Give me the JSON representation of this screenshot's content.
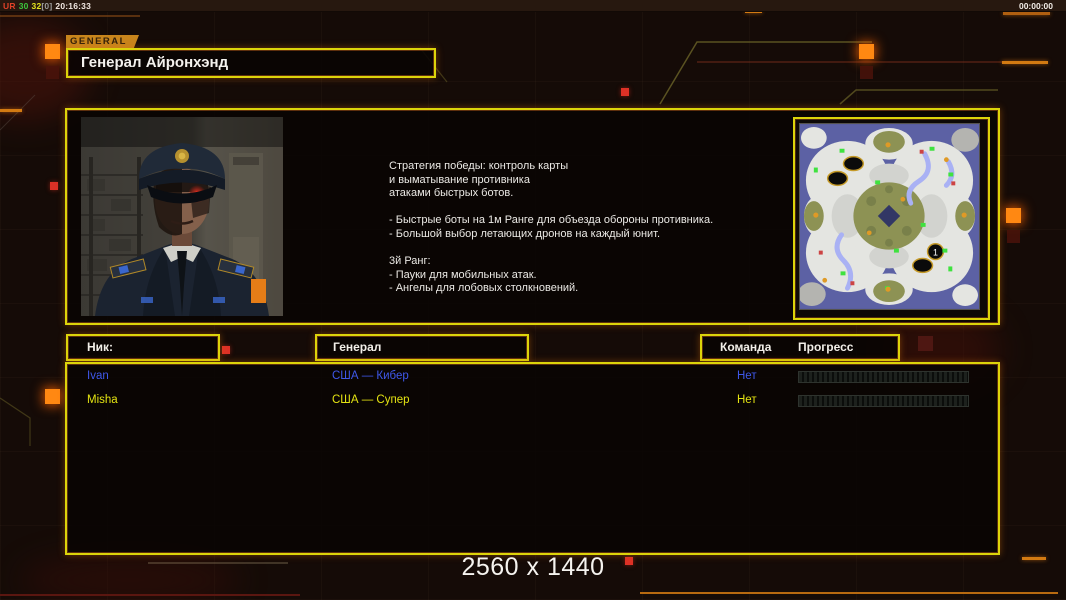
{
  "status_bar": {
    "left_parts": [
      {
        "text": "UR",
        "color": "#e04228"
      },
      {
        "text": "30",
        "color": "#3cc63c"
      },
      {
        "text": "32",
        "color": "#e6e61e"
      },
      {
        "text": "[0]",
        "color": "#9c9c9c"
      },
      {
        "text": "20:16:33",
        "color": "#f2e8e2"
      }
    ],
    "timer": "00:00:00"
  },
  "general_tab": {
    "label": "GENERAL"
  },
  "title": {
    "text": "Генерал Айронхэнд"
  },
  "briefing": {
    "strategy_text": "Стратегия победы: контроль карты\nи выматывание противника\nатаками быстрых ботов.\n\n- Быстрые боты на 1м Ранге для объезда обороны противника.\n- Большой выбор летающих дронов на каждый юнит.\n\n3й Ранг:\n- Пауки для мобильных атак.\n- Ангелы для лобовых столкновений.",
    "map_marker": "1"
  },
  "players": {
    "headers": {
      "nick": "Ник:",
      "general": "Генерал",
      "team": "Команда",
      "progress": "Прогресс"
    },
    "rows": [
      {
        "nick": "Ivan",
        "general": "США — Кибер",
        "team": "Нет",
        "progress_percent": 0,
        "text_color": "#3f58ea"
      },
      {
        "nick": "Misha",
        "general": "США — Супер",
        "team": "Нет",
        "progress_percent": 0,
        "text_color": "#e4e412"
      }
    ]
  },
  "footer": {
    "resolution_label": "2560 x 1440"
  },
  "colors": {
    "panel_border_yellow": "#dcd40a",
    "inner_border_orange": "#a85a1c",
    "accent_orange": "#ff8812",
    "decor_red": "#dd3126",
    "map_background_blue": "#5c61a4",
    "tab_background": "#c8851c"
  }
}
